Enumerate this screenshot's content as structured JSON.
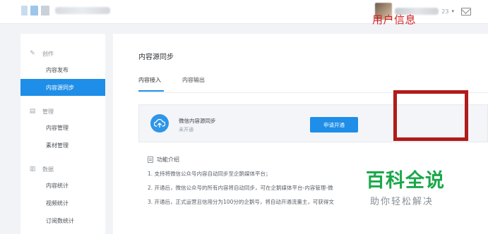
{
  "topbar": {
    "uid_suffix": "23",
    "caret": "▾"
  },
  "annotation": {
    "user_info": "用户信息"
  },
  "sidebar": {
    "sections": [
      {
        "title": "创作",
        "icon": "edit-icon",
        "items": [
          {
            "label": "内容发布",
            "active": false
          },
          {
            "label": "内容源同步",
            "active": true
          }
        ]
      },
      {
        "title": "管理",
        "icon": "manage-icon",
        "items": [
          {
            "label": "内容管理",
            "active": false
          },
          {
            "label": "素材管理",
            "active": false
          }
        ]
      },
      {
        "title": "数据",
        "icon": "chart-icon",
        "items": [
          {
            "label": "内容统计",
            "active": false
          },
          {
            "label": "视频统计",
            "active": false
          },
          {
            "label": "订阅数统计",
            "active": false
          }
        ]
      }
    ]
  },
  "main": {
    "title": "内容源同步",
    "tabs": [
      {
        "label": "内容接入",
        "active": true
      },
      {
        "label": "内容输出",
        "active": false
      }
    ],
    "card": {
      "title": "微信内容源同步",
      "status": "未开通",
      "icon": "cloud-upload-icon"
    },
    "apply_button": "申请开通",
    "intro": {
      "heading": "功能介绍",
      "lines": [
        "1. 支持将微信公众号内容自动同步至企鹅媒体平台；",
        "2. 开通后，微信公众号的所有内容将自动同步，可在企鹅媒体平台-内容管理-微",
        "3. 开通后，正式运营且信用分为100分的企鹅号，将自动开通流量主，可获得文"
      ]
    }
  },
  "watermark": {
    "big": "百科全说",
    "small": "助你轻松解决"
  },
  "colors": {
    "accent": "#1e8ee8",
    "annotation_red": "#d21f1f",
    "watermark_green": "#1aa84a"
  }
}
